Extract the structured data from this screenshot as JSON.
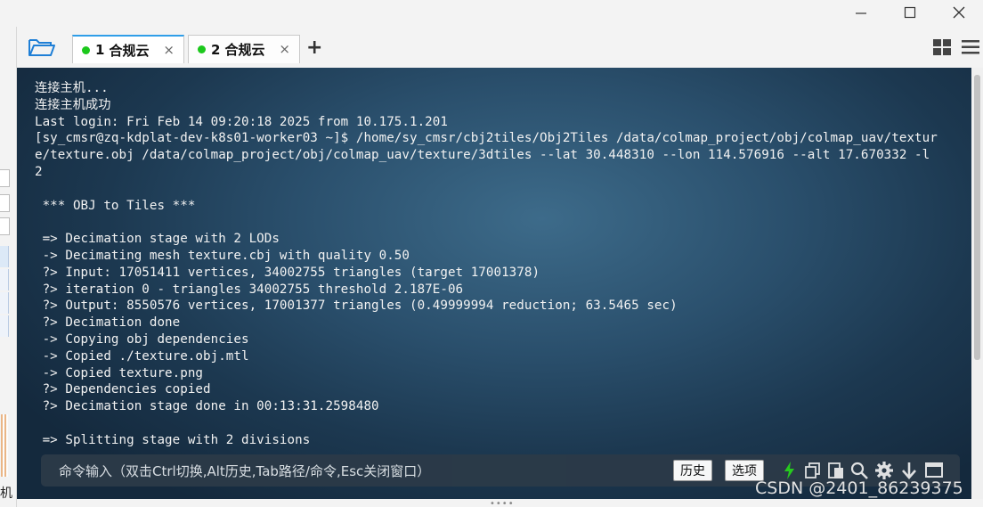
{
  "window": {
    "minimize_glyph": "—",
    "maximize_glyph": "☐",
    "close_glyph": "✕"
  },
  "left_panel": {
    "visible_char": "机"
  },
  "tabs": [
    {
      "number": "1",
      "name": "合规云",
      "status_color": "#1cc81c",
      "active": true,
      "close_glyph": "×"
    },
    {
      "number": "2",
      "name": "合规云",
      "status_color": "#1cc81c",
      "active": false,
      "close_glyph": "×"
    }
  ],
  "toolbar": {
    "add_tab_glyph": "+",
    "open_folder_icon": "folder-open-icon",
    "layout_icon": "grid-icon",
    "menu_icon": "hamburger-menu-icon"
  },
  "terminal": {
    "lines": [
      "连接主机...",
      "连接主机成功",
      "Last login: Fri Feb 14 09:20:18 2025 from 10.175.1.201",
      "[sy_cmsr@zq-kdplat-dev-k8s01-worker03 ~]$ /home/sy_cmsr/cbj2tiles/Obj2Tiles /data/colmap_project/obj/colmap_uav/textur",
      "e/texture.obj /data/colmap_project/obj/colmap_uav/texture/3dtiles --lat 30.448310 --lon 114.576916 --alt 17.670332 -l",
      "2",
      "",
      " *** OBJ to Tiles ***",
      "",
      " => Decimation stage with 2 LODs",
      " -> Decimating mesh texture.cbj with quality 0.50",
      " ?> Input: 17051411 vertices, 34002755 triangles (target 17001378)",
      " ?> iteration 0 - triangles 34002755 threshold 2.187E-06",
      " ?> Output: 8550576 vertices, 17001377 triangles (0.49999994 reduction; 63.5465 sec)",
      " ?> Decimation done",
      " -> Copying obj dependencies",
      " -> Copied ./texture.obj.mtl",
      " -> Copied texture.png",
      " ?> Dependencies copied",
      " ?> Decimation stage done in 00:13:31.2598480",
      "",
      " => Splitting stage with 2 divisions"
    ]
  },
  "command_bar": {
    "hint": "命令输入（双击Ctrl切换,Alt历史,Tab路径/命令,Esc关闭窗口）",
    "history_label": "历史",
    "options_label": "选项",
    "icons": [
      "lightning-icon",
      "copy-icon",
      "paste-icon",
      "search-icon",
      "gear-icon",
      "download-icon",
      "window-icon"
    ],
    "lightning_color": "#27d11d"
  },
  "watermark": "CSDN @2401_86239375"
}
